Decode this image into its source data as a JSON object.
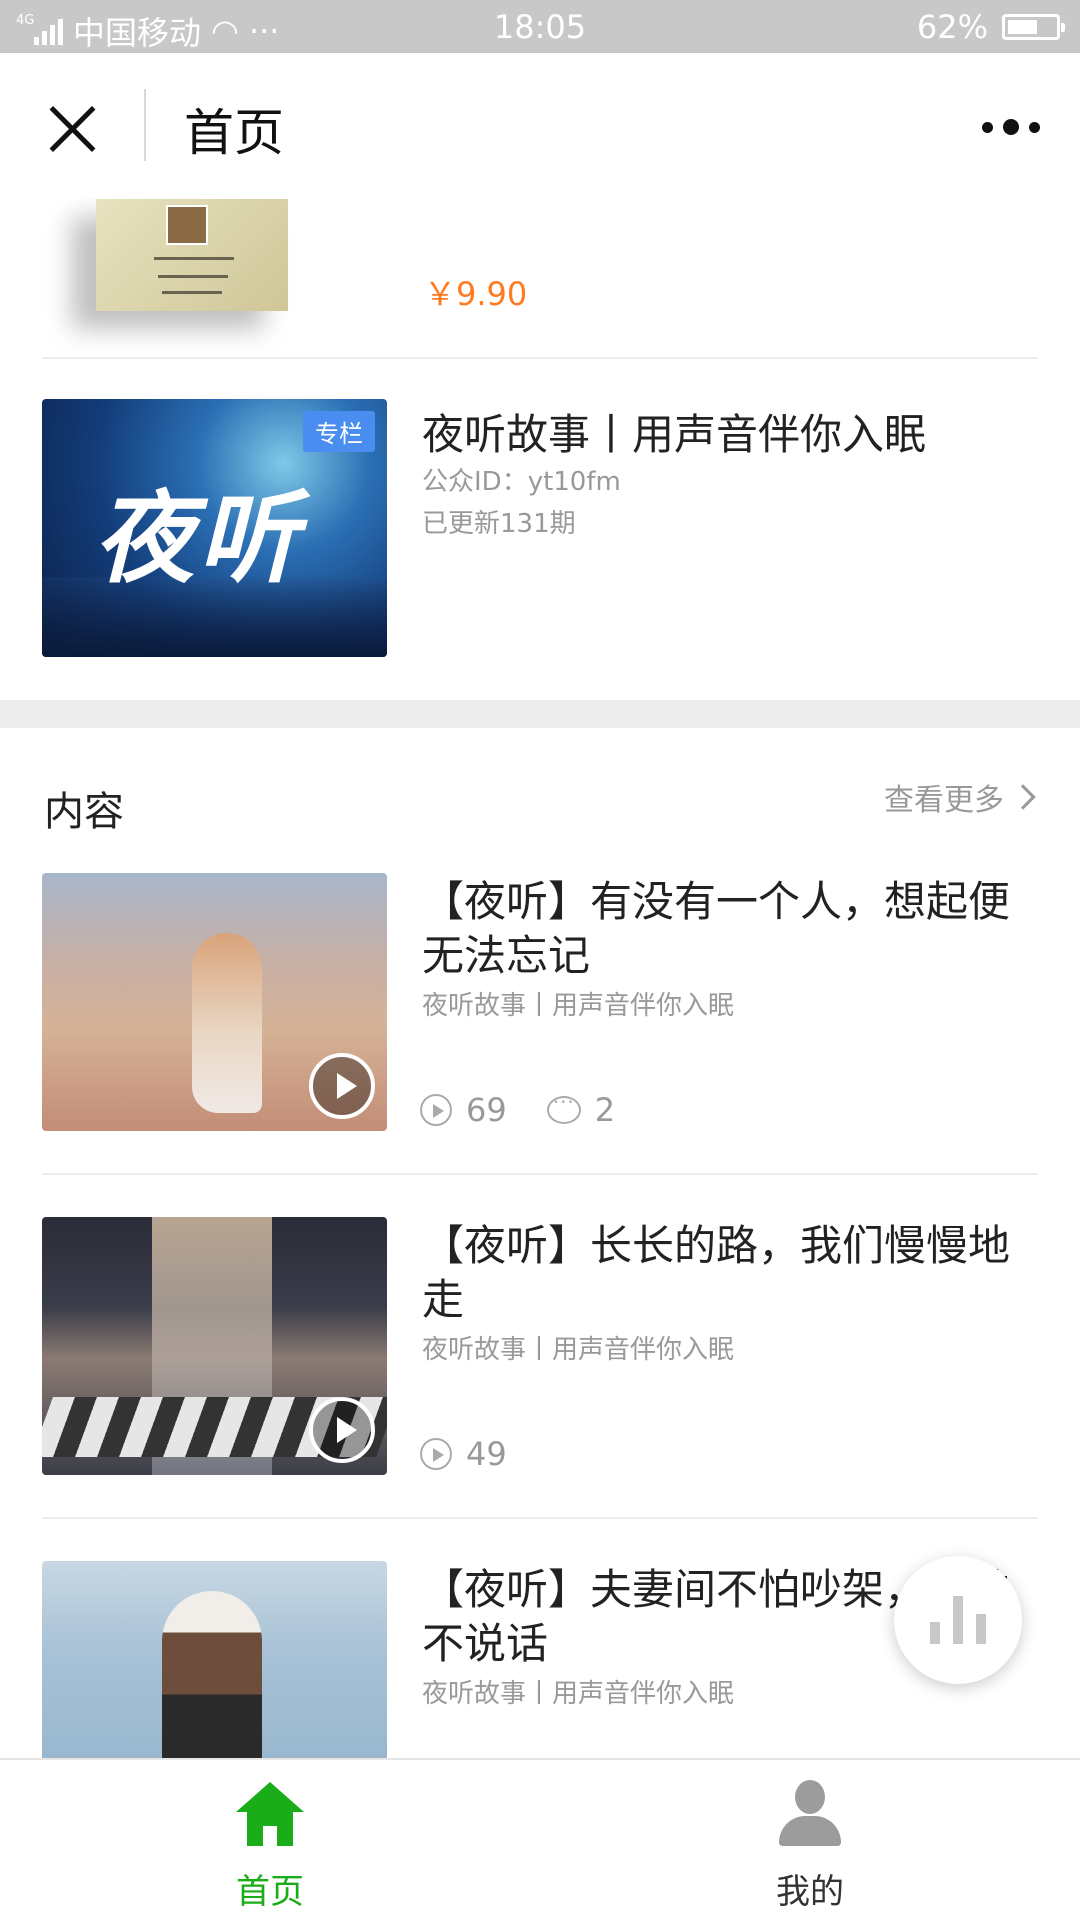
{
  "status_bar": {
    "network": "4G",
    "carrier": "中国移动",
    "time": "18:05",
    "battery_percent": "62%",
    "battery_level": 0.62
  },
  "header": {
    "title": "首页",
    "close_icon": "close-icon",
    "more_icon": "more-icon"
  },
  "book": {
    "price": "￥9.90"
  },
  "column": {
    "tag": "专栏",
    "cover_text": "夜听",
    "title": "夜听故事丨用声音伴你入眠",
    "account_id": "公众ID：yt10fm",
    "updates": "已更新131期"
  },
  "content_section": {
    "title": "内容",
    "see_more": "查看更多"
  },
  "items": [
    {
      "title": "【夜听】有没有一个人，想起便无法忘记",
      "subtitle": "夜听故事丨用声音伴你入眠",
      "plays": "69",
      "comments": "2"
    },
    {
      "title": "【夜听】长长的路，我们慢慢地走",
      "subtitle": "夜听故事丨用声音伴你入眠",
      "plays": "49"
    },
    {
      "title": "【夜听】夫妻间不怕吵架，就怕不说话",
      "subtitle": "夜听故事丨用声音伴你入眠"
    }
  ],
  "tabbar": {
    "home_label": "首页",
    "me_label": "我的",
    "active_color": "#1aad19"
  },
  "colors": {
    "price": "#ff7a21",
    "tag_bg": "#4a8df0"
  }
}
